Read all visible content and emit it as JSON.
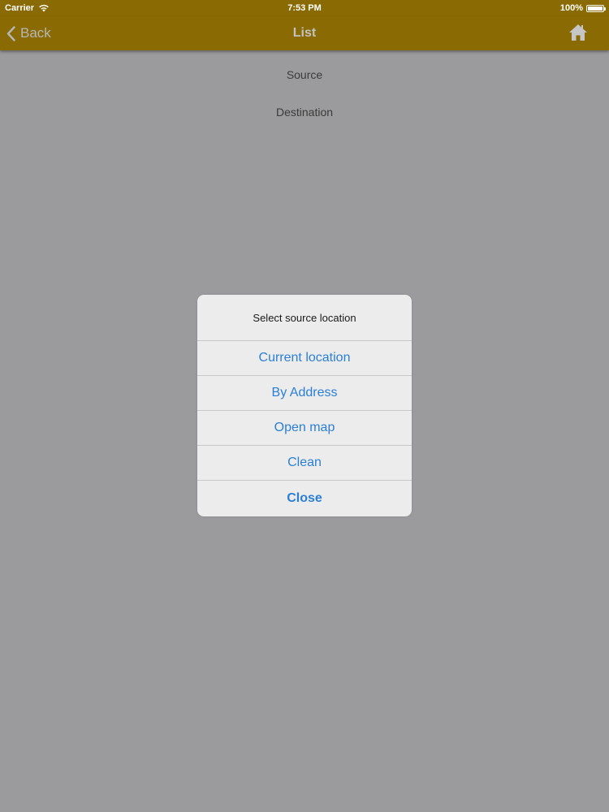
{
  "status_bar": {
    "carrier": "Carrier",
    "time": "7:53 PM",
    "battery": "100%",
    "battery_level": 1.0
  },
  "nav_bar": {
    "back_label": "Back",
    "title": "List",
    "home_icon": "home-icon",
    "color": "#8a6a02"
  },
  "content": {
    "source_label": "Source",
    "destination_label": "Destination"
  },
  "alert": {
    "title": "Select source location",
    "buttons": [
      {
        "label": "Current location"
      },
      {
        "label": "By Address"
      },
      {
        "label": "Open map"
      },
      {
        "label": "Clean"
      },
      {
        "label": "Close"
      }
    ],
    "accent": "#2b7fd6"
  }
}
